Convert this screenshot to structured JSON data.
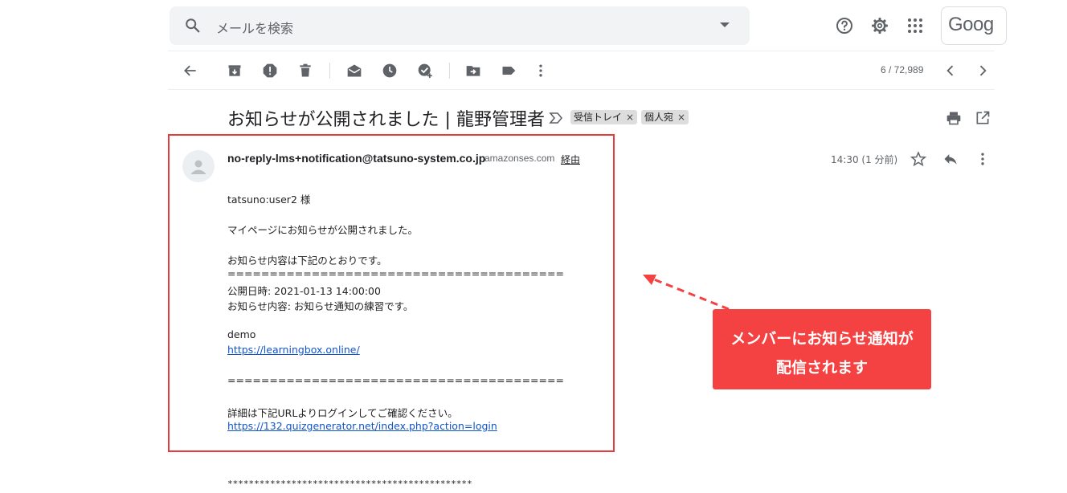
{
  "search": {
    "placeholder": "メールを検索"
  },
  "header": {
    "logo_text": "Goog"
  },
  "toolbar": {
    "pager": "6 / 72,989"
  },
  "message": {
    "subject": "お知らせが公開されました | 龍野管理者",
    "labels": [
      "受信トレイ",
      "個人宛"
    ],
    "label_remove": "×",
    "sender": "no-reply-lms+notification@tatsuno-system.co.jp",
    "via_domain": "amazonses.com",
    "via_label": "経由",
    "time": "14:30 (1 分前)",
    "body": [
      "tatsuno:user2 様",
      "マイページにお知らせが公開されました。",
      "お知らせ内容は下記のとおりです。",
      "========================================",
      "公開日時: 2021-01-13 14:00:00",
      "お知らせ内容: お知らせ通知の練習です。",
      "demo",
      "https://learningbox.online/",
      "========================================",
      "詳細は下記URLよりログインしてご確認ください。",
      "https://132.quizgenerator.net/index.php?action=login"
    ],
    "trailing": "**********************************************"
  },
  "annotation": {
    "line1": "メンバーにお知らせ通知が",
    "line2": "配信されます",
    "color": "#f44242",
    "box_color": "#e63b3b"
  },
  "icons": {
    "search": "search-icon",
    "help": "help-icon",
    "settings": "gear-icon",
    "apps": "apps-grid-icon",
    "back": "back-arrow-icon",
    "archive": "archive-icon",
    "spam": "report-spam-icon",
    "delete": "trash-icon",
    "unread": "mark-unread-icon",
    "snooze": "clock-icon",
    "task": "add-task-icon",
    "move": "move-to-icon",
    "label": "label-icon",
    "more": "more-vert-icon",
    "prev": "chevron-left-icon",
    "next": "chevron-right-icon",
    "print": "print-icon",
    "popout": "open-new-window-icon",
    "star": "star-icon",
    "reply": "reply-icon"
  }
}
